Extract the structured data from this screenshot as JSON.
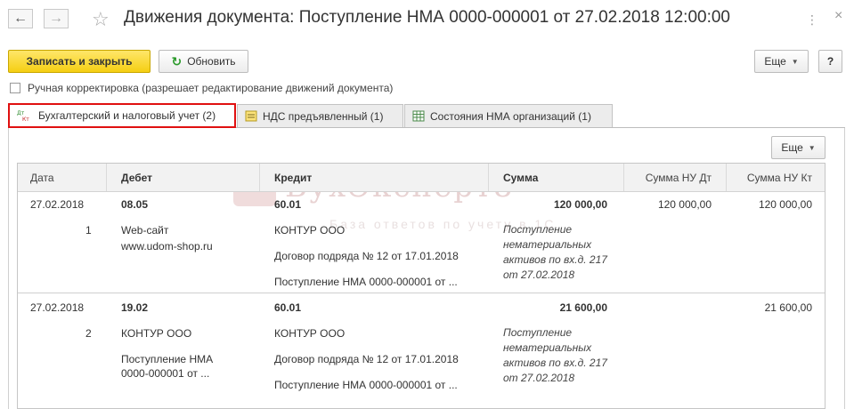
{
  "window": {
    "title": "Движения документа: Поступление НМА 0000-000001 от 27.02.2018 12:00:00",
    "more_dots": "⋮",
    "close_glyph": "×"
  },
  "toolbar": {
    "save_close": "Записать и закрыть",
    "refresh": "Обновить",
    "more": "Еще",
    "help": "?"
  },
  "manual_edit": {
    "label": "Ручная корректировка (разрешает редактирование движений документа)",
    "checked": false
  },
  "tabs": [
    {
      "label": "Бухгалтерский и налоговый учет (2)",
      "icon": "dt-kt-icon",
      "active": true
    },
    {
      "label": "НДС предъявленный (1)",
      "icon": "register-icon",
      "active": false
    },
    {
      "label": "Состояния НМА организаций (1)",
      "icon": "table-icon",
      "active": false
    }
  ],
  "table_more": "Еще",
  "columns": [
    "Дата",
    "Дебет",
    "Кредит",
    "Сумма",
    "Сумма НУ Дт",
    "Сумма НУ Кт"
  ],
  "rows": [
    {
      "date": "27.02.2018",
      "num": "1",
      "debit_account": "08.05",
      "debit_sub1": "Web-сайт",
      "debit_sub2": "www.udom-shop.ru",
      "credit_account": "60.01",
      "credit_sub1": "КОНТУР ООО",
      "credit_sub2": "Договор подряда № 12 от 17.01.2018",
      "credit_sub3": "Поступление НМА 0000-000001 от ...",
      "amount": "120 000,00",
      "content": "Поступление нематериальных активов по вх.д. 217 от 27.02.2018",
      "nu_dt": "120 000,00",
      "nu_kt": "120 000,00"
    },
    {
      "date": "27.02.2018",
      "num": "2",
      "debit_account": "19.02",
      "debit_sub1": "КОНТУР ООО",
      "debit_sub2": "Поступление НМА",
      "debit_sub3": "0000-000001 от ...",
      "credit_account": "60.01",
      "credit_sub1": "КОНТУР ООО",
      "credit_sub2": "Договор подряда № 12 от 17.01.2018",
      "credit_sub3": "Поступление НМА 0000-000001 от ...",
      "amount": "21 600,00",
      "content": "Поступление нематериальных активов по вх.д. 217 от 27.02.2018",
      "nu_dt": "",
      "nu_kt": "21 600,00"
    }
  ],
  "watermark": {
    "main": "БухЭксперт8",
    "sub": "База ответов по учету в 1С"
  }
}
